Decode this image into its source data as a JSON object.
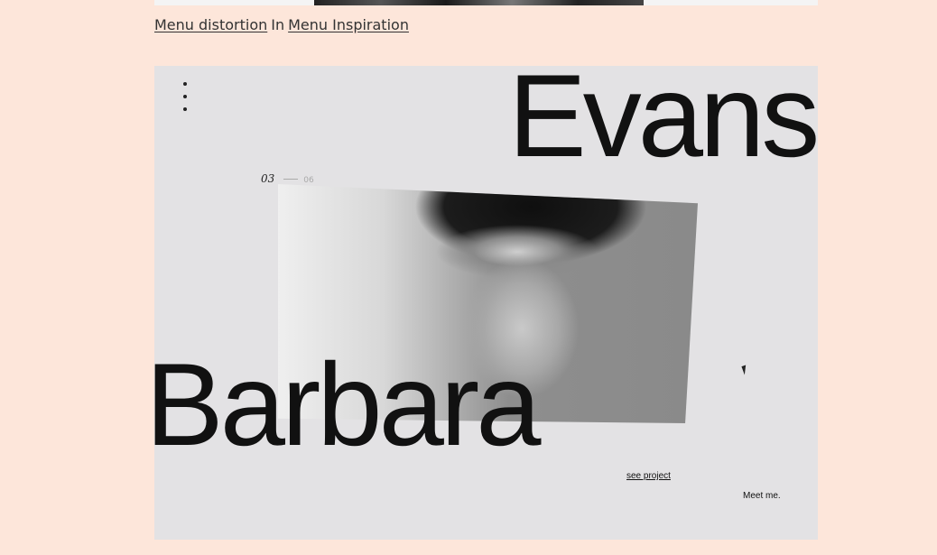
{
  "caption": {
    "link1": "Menu distortion",
    "separator": "In",
    "link2": "Menu Inspiration"
  },
  "panel": {
    "title_top": "Evans",
    "title_bottom": "Barbara",
    "counter_current": "03",
    "counter_total": "06",
    "see_project": "see project",
    "meet_me": "Meet me.",
    "photo_subject": "portrait-photo"
  },
  "colors": {
    "page_background": "#fde6da",
    "panel_background": "#e3e2e4",
    "text": "#111111"
  }
}
